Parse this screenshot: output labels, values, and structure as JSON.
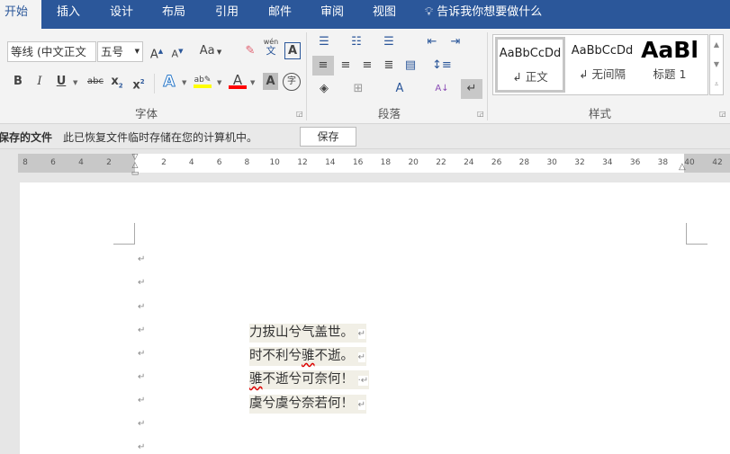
{
  "tabs": [
    {
      "label": "开始",
      "active": true
    },
    {
      "label": "插入"
    },
    {
      "label": "设计"
    },
    {
      "label": "布局"
    },
    {
      "label": "引用"
    },
    {
      "label": "邮件"
    },
    {
      "label": "审阅"
    },
    {
      "label": "视图"
    }
  ],
  "tell_me": "告诉我你想要做什么",
  "font": {
    "name": "等线 (中文正文",
    "size": "五号",
    "change_case": "Aa",
    "group_label": "字体",
    "icons": [
      "grow-font",
      "shrink-font",
      "change-case",
      "clear-formatting",
      "phonetic-guide",
      "character-border",
      "bold",
      "italic",
      "underline",
      "strikethrough",
      "subscript",
      "superscript",
      "text-effects",
      "highlight",
      "font-color",
      "character-shading",
      "enclosed-character"
    ],
    "highlight_color": "#ffff00",
    "font_color": "#ff0000",
    "phonetic_top": "wén",
    "phonetic_bottom": "文",
    "enclosed": "字",
    "bold": "B",
    "italic": "I",
    "underline": "U",
    "strike": "abc"
  },
  "paragraph": {
    "group_label": "段落"
  },
  "styles": {
    "group_label": "样式",
    "items": [
      {
        "preview": "AaBbCcDd",
        "name": "正文",
        "selected": true
      },
      {
        "preview": "AaBbCcDd",
        "name": "无间隔"
      },
      {
        "preview": "AaBl",
        "name": "标题 1"
      }
    ]
  },
  "infobar": {
    "title": "保存的文件",
    "message": "此已恢复文件临时存储在您的计算机中。",
    "save_label": "保存"
  },
  "ruler": {
    "left": [
      "8",
      "6",
      "4",
      "2"
    ],
    "right": [
      "2",
      "4",
      "6",
      "8",
      "10",
      "12",
      "14",
      "16",
      "18",
      "20",
      "22",
      "24",
      "26",
      "28",
      "30",
      "32",
      "34",
      "36",
      "38"
    ],
    "margin_right": [
      "40",
      "42"
    ]
  },
  "document": {
    "paragraph_mark": "↵",
    "lines": [
      {
        "text": "力拔山兮气盖世。",
        "parts": [
          "力拔山兮气盖世。"
        ]
      },
      {
        "text": "时不利兮骓不逝。",
        "parts": [
          "时不利兮",
          "骓",
          "不逝。"
        ]
      },
      {
        "text": "骓不逝兮可奈何！",
        "parts": [
          "骓",
          "不逝兮可奈何！"
        ]
      },
      {
        "text": "虞兮虞兮奈若何！",
        "parts": [
          "虞兮虞兮奈若何！"
        ]
      }
    ]
  },
  "colors": {
    "accent": "#2b579a"
  }
}
